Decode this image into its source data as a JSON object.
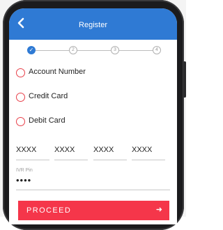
{
  "header": {
    "title": "Register",
    "back_icon": "chevron-left-icon"
  },
  "stepper": {
    "steps": [
      "✓",
      "2",
      "3",
      "4"
    ],
    "current": 1
  },
  "options": [
    {
      "label": "Account Number"
    },
    {
      "label": "Credit Card"
    },
    {
      "label": "Debit Card"
    }
  ],
  "card_number": {
    "fields": [
      "XXXX",
      "XXXX",
      "XXXX",
      "XXXX"
    ]
  },
  "ivr_pin": {
    "label": "IVR Pin",
    "value": "••••"
  },
  "proceed": {
    "label": "PROCEED",
    "arrow": "➜"
  },
  "colors": {
    "primary": "#2f7ad4",
    "accent": "#f5364a"
  }
}
